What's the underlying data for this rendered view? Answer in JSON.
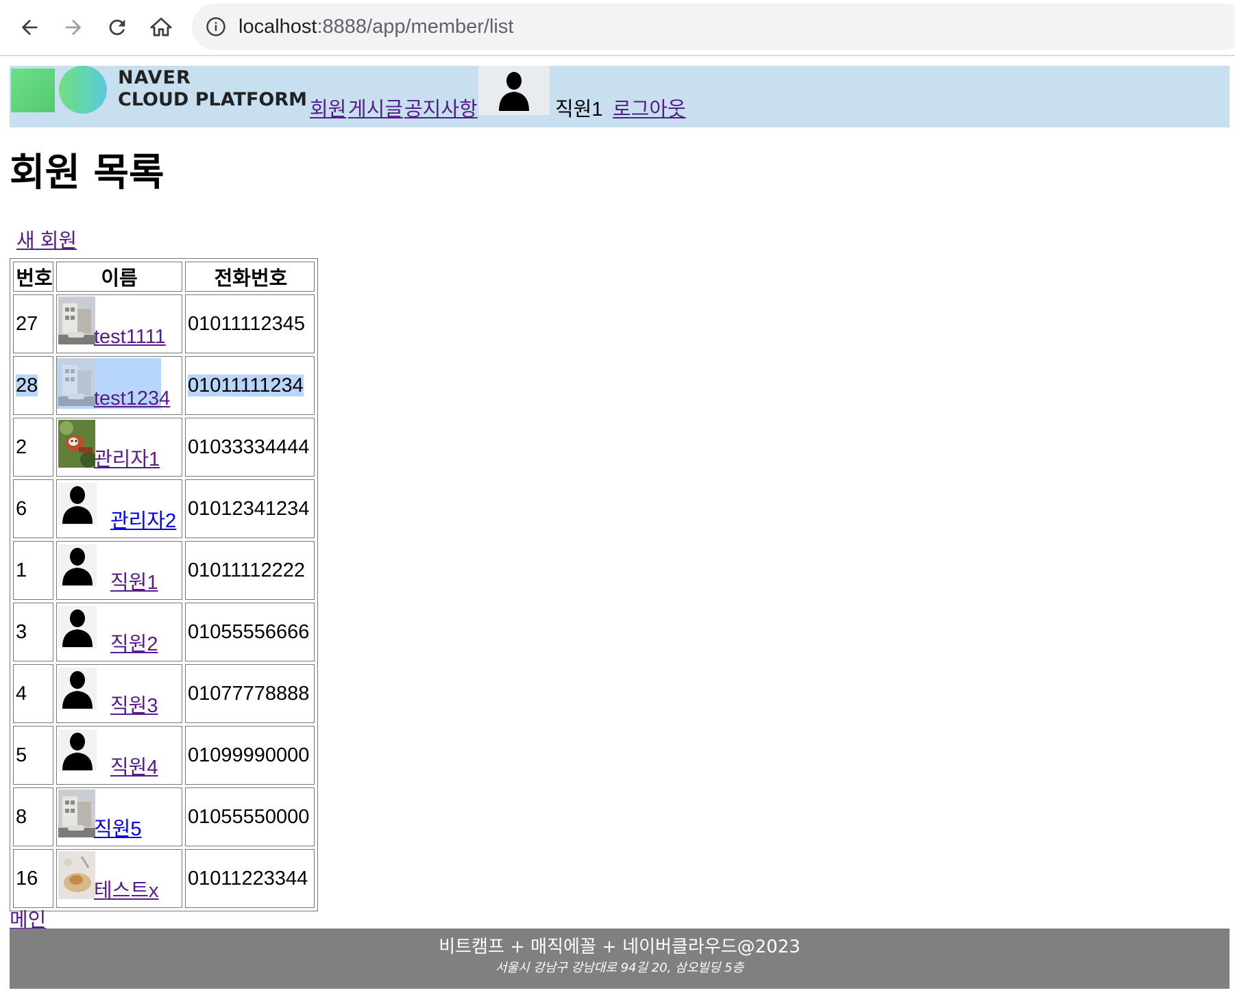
{
  "browser": {
    "url_host": "localhost",
    "url_path": ":8888/app/member/list"
  },
  "header": {
    "logo_line1": "NAVER",
    "logo_line2": "CLOUD PLATFORM",
    "nav": [
      "회원",
      "게시글",
      "공지사항"
    ],
    "user_name": "직원1",
    "logout": "로그아웃"
  },
  "page": {
    "title": "회원 목록",
    "new_member_link": "새 회원"
  },
  "table": {
    "headers": [
      "번호",
      "이름",
      "전화번호"
    ],
    "rows": [
      {
        "no": "27",
        "name": "test1111",
        "tel": "01011112345",
        "thumb": "photo-building"
      },
      {
        "no": "28",
        "name": "test1234",
        "tel": "01011111234",
        "thumb": "photo-building",
        "selected": true
      },
      {
        "no": "2",
        "name": "관리자1",
        "tel": "01033334444",
        "thumb": "photo-red-panda"
      },
      {
        "no": "6",
        "name": "관리자2",
        "tel": "01012341234",
        "thumb": "avatar"
      },
      {
        "no": "1",
        "name": "직원1",
        "tel": "01011112222",
        "thumb": "avatar"
      },
      {
        "no": "3",
        "name": "직원2",
        "tel": "01055556666",
        "thumb": "avatar"
      },
      {
        "no": "4",
        "name": "직원3",
        "tel": "01077778888",
        "thumb": "avatar"
      },
      {
        "no": "5",
        "name": "직원4",
        "tel": "01099990000",
        "thumb": "avatar"
      },
      {
        "no": "8",
        "name": "직원5",
        "tel": "01055550000",
        "thumb": "photo-building"
      },
      {
        "no": "16",
        "name": "테스트x",
        "tel": "01011223344",
        "thumb": "photo-food"
      }
    ]
  },
  "main_link": "메인",
  "footer": {
    "line1": "비트캠프 + 매직에꼴 + 네이버클라우드@2023",
    "line2": "서울시 강남구 강남대로 94길 20, 삼오빌딩 5층"
  },
  "colors": {
    "header_bg": "#c7dfee",
    "footer_bg": "#808080",
    "visited_link": "#551a8b",
    "link": "#0000ee",
    "selection": "#b8d5fb"
  }
}
